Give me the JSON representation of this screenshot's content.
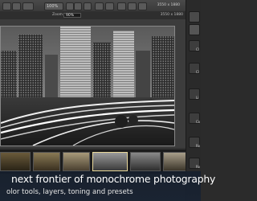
{
  "toolbar": {
    "zoom_display": "100%",
    "dimensions": "3550 x 1880"
  },
  "zoombar": {
    "zoom_label": "Zoom",
    "zoom_value": "90%",
    "dimensions": "3550 x 1880"
  },
  "sidebar": {
    "items": [
      {
        "icon": "grid-icon"
      },
      {
        "icon": "landscape-icon"
      },
      {
        "icon": "toning-icon"
      },
      {
        "icon": "presets-icon"
      },
      {
        "icon": "layers-icon"
      },
      {
        "icon": "adjust-icon"
      }
    ],
    "labels": [
      "Cl",
      "Cl",
      "Li",
      "Co",
      "Ro",
      "Ro"
    ]
  },
  "banner": {
    "headline": "next frontier of monochrome photography",
    "subline": "olor tools, layers, toning and presets"
  },
  "colors": {
    "banner_bg": "#1a2433",
    "selected_thumb_border": "#e8d79a"
  }
}
